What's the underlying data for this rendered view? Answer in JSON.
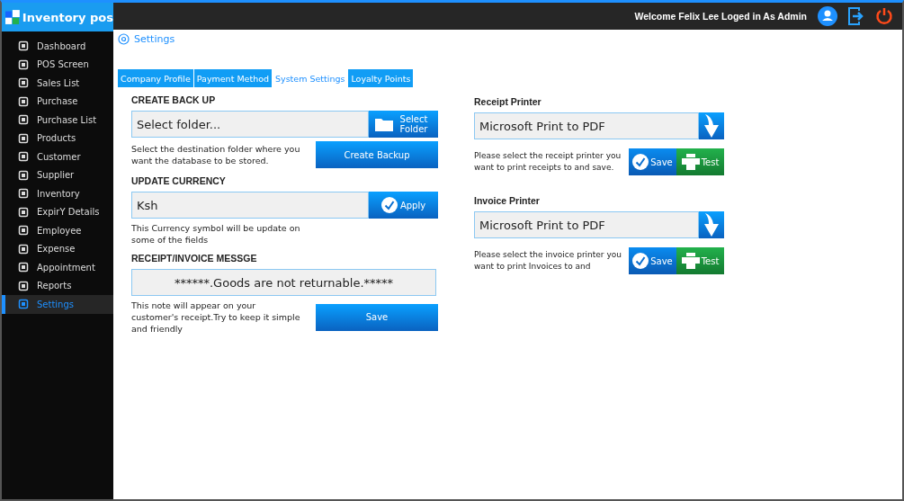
{
  "logo": {
    "text": "Inventory pos"
  },
  "sidebar": {
    "items": [
      {
        "label": "Dashboard",
        "selected": false
      },
      {
        "label": "POS Screen",
        "selected": false
      },
      {
        "label": "Sales List",
        "selected": false
      },
      {
        "label": "Purchase",
        "selected": false
      },
      {
        "label": "Purchase List",
        "selected": false
      },
      {
        "label": "Products",
        "selected": false
      },
      {
        "label": "Customer",
        "selected": false
      },
      {
        "label": "Supplier",
        "selected": false
      },
      {
        "label": "Inventory",
        "selected": false
      },
      {
        "label": "ExpirY Details",
        "selected": false
      },
      {
        "label": "Employee",
        "selected": false
      },
      {
        "label": "Expense",
        "selected": false
      },
      {
        "label": "Appointment",
        "selected": false
      },
      {
        "label": "Reports",
        "selected": false
      },
      {
        "label": "Settings",
        "selected": true
      }
    ]
  },
  "header": {
    "welcome": "Welcome Felix Lee Loged in As Admin"
  },
  "page_title": "Settings",
  "tabs": [
    {
      "label": "Company Profile",
      "selected": false
    },
    {
      "label": "Payment Method",
      "selected": false
    },
    {
      "label": "System Settings",
      "selected": true
    },
    {
      "label": "Loyalty Points",
      "selected": false
    }
  ],
  "backup": {
    "heading": "CREATE BACK UP",
    "placeholder": "Select folder...",
    "select_button": "Select Folder",
    "hint": "Select the destination folder where you want the database to be stored.",
    "create_button": "Create Backup"
  },
  "currency": {
    "heading": "UPDATE CURRENCY",
    "value": "Ksh",
    "apply_button": "Apply",
    "hint": "This Currency symbol will be update on some of the fields"
  },
  "message": {
    "heading": "RECEIPT/INVOICE MESSGE",
    "value": "******.Goods are not returnable.*****",
    "hint": "This note will appear on your customer's receipt.Try to keep it simple and friendly",
    "save_button": "Save"
  },
  "printers": [
    {
      "heading": "Receipt Printer",
      "value": "Microsoft Print to PDF",
      "hint": "Please select the receipt printer you want to print receipts to and save.",
      "save_button": "Save",
      "test_button": "Test"
    },
    {
      "heading": "Invoice Printer",
      "value": "Microsoft Print to PDF",
      "hint": "Please select the invoice printer you want to print Invoices to and",
      "save_button": "Save",
      "test_button": "Test"
    }
  ]
}
